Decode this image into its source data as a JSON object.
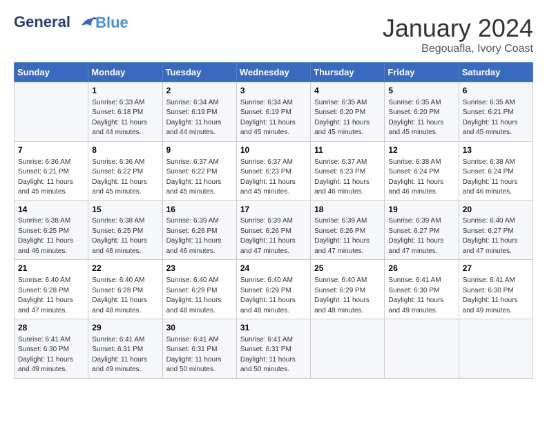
{
  "header": {
    "logo_line1": "General",
    "logo_line2": "Blue",
    "month": "January 2024",
    "location": "Begouafla, Ivory Coast"
  },
  "days_of_week": [
    "Sunday",
    "Monday",
    "Tuesday",
    "Wednesday",
    "Thursday",
    "Friday",
    "Saturday"
  ],
  "weeks": [
    [
      {
        "day": "",
        "info": ""
      },
      {
        "day": "1",
        "info": "Sunrise: 6:33 AM\nSunset: 6:18 PM\nDaylight: 11 hours\nand 44 minutes."
      },
      {
        "day": "2",
        "info": "Sunrise: 6:34 AM\nSunset: 6:19 PM\nDaylight: 11 hours\nand 44 minutes."
      },
      {
        "day": "3",
        "info": "Sunrise: 6:34 AM\nSunset: 6:19 PM\nDaylight: 11 hours\nand 45 minutes."
      },
      {
        "day": "4",
        "info": "Sunrise: 6:35 AM\nSunset: 6:20 PM\nDaylight: 11 hours\nand 45 minutes."
      },
      {
        "day": "5",
        "info": "Sunrise: 6:35 AM\nSunset: 6:20 PM\nDaylight: 11 hours\nand 45 minutes."
      },
      {
        "day": "6",
        "info": "Sunrise: 6:35 AM\nSunset: 6:21 PM\nDaylight: 11 hours\nand 45 minutes."
      }
    ],
    [
      {
        "day": "7",
        "info": "Sunrise: 6:36 AM\nSunset: 6:21 PM\nDaylight: 11 hours\nand 45 minutes."
      },
      {
        "day": "8",
        "info": "Sunrise: 6:36 AM\nSunset: 6:22 PM\nDaylight: 11 hours\nand 45 minutes."
      },
      {
        "day": "9",
        "info": "Sunrise: 6:37 AM\nSunset: 6:22 PM\nDaylight: 11 hours\nand 45 minutes."
      },
      {
        "day": "10",
        "info": "Sunrise: 6:37 AM\nSunset: 6:23 PM\nDaylight: 11 hours\nand 45 minutes."
      },
      {
        "day": "11",
        "info": "Sunrise: 6:37 AM\nSunset: 6:23 PM\nDaylight: 11 hours\nand 46 minutes."
      },
      {
        "day": "12",
        "info": "Sunrise: 6:38 AM\nSunset: 6:24 PM\nDaylight: 11 hours\nand 46 minutes."
      },
      {
        "day": "13",
        "info": "Sunrise: 6:38 AM\nSunset: 6:24 PM\nDaylight: 11 hours\nand 46 minutes."
      }
    ],
    [
      {
        "day": "14",
        "info": "Sunrise: 6:38 AM\nSunset: 6:25 PM\nDaylight: 11 hours\nand 46 minutes."
      },
      {
        "day": "15",
        "info": "Sunrise: 6:38 AM\nSunset: 6:25 PM\nDaylight: 11 hours\nand 46 minutes."
      },
      {
        "day": "16",
        "info": "Sunrise: 6:39 AM\nSunset: 6:26 PM\nDaylight: 11 hours\nand 46 minutes."
      },
      {
        "day": "17",
        "info": "Sunrise: 6:39 AM\nSunset: 6:26 PM\nDaylight: 11 hours\nand 47 minutes."
      },
      {
        "day": "18",
        "info": "Sunrise: 6:39 AM\nSunset: 6:26 PM\nDaylight: 11 hours\nand 47 minutes."
      },
      {
        "day": "19",
        "info": "Sunrise: 6:39 AM\nSunset: 6:27 PM\nDaylight: 11 hours\nand 47 minutes."
      },
      {
        "day": "20",
        "info": "Sunrise: 6:40 AM\nSunset: 6:27 PM\nDaylight: 11 hours\nand 47 minutes."
      }
    ],
    [
      {
        "day": "21",
        "info": "Sunrise: 6:40 AM\nSunset: 6:28 PM\nDaylight: 11 hours\nand 47 minutes."
      },
      {
        "day": "22",
        "info": "Sunrise: 6:40 AM\nSunset: 6:28 PM\nDaylight: 11 hours\nand 48 minutes."
      },
      {
        "day": "23",
        "info": "Sunrise: 6:40 AM\nSunset: 6:29 PM\nDaylight: 11 hours\nand 48 minutes."
      },
      {
        "day": "24",
        "info": "Sunrise: 6:40 AM\nSunset: 6:29 PM\nDaylight: 11 hours\nand 48 minutes."
      },
      {
        "day": "25",
        "info": "Sunrise: 6:40 AM\nSunset: 6:29 PM\nDaylight: 11 hours\nand 48 minutes."
      },
      {
        "day": "26",
        "info": "Sunrise: 6:41 AM\nSunset: 6:30 PM\nDaylight: 11 hours\nand 49 minutes."
      },
      {
        "day": "27",
        "info": "Sunrise: 6:41 AM\nSunset: 6:30 PM\nDaylight: 11 hours\nand 49 minutes."
      }
    ],
    [
      {
        "day": "28",
        "info": "Sunrise: 6:41 AM\nSunset: 6:30 PM\nDaylight: 11 hours\nand 49 minutes."
      },
      {
        "day": "29",
        "info": "Sunrise: 6:41 AM\nSunset: 6:31 PM\nDaylight: 11 hours\nand 49 minutes."
      },
      {
        "day": "30",
        "info": "Sunrise: 6:41 AM\nSunset: 6:31 PM\nDaylight: 11 hours\nand 50 minutes."
      },
      {
        "day": "31",
        "info": "Sunrise: 6:41 AM\nSunset: 6:31 PM\nDaylight: 11 hours\nand 50 minutes."
      },
      {
        "day": "",
        "info": ""
      },
      {
        "day": "",
        "info": ""
      },
      {
        "day": "",
        "info": ""
      }
    ]
  ]
}
